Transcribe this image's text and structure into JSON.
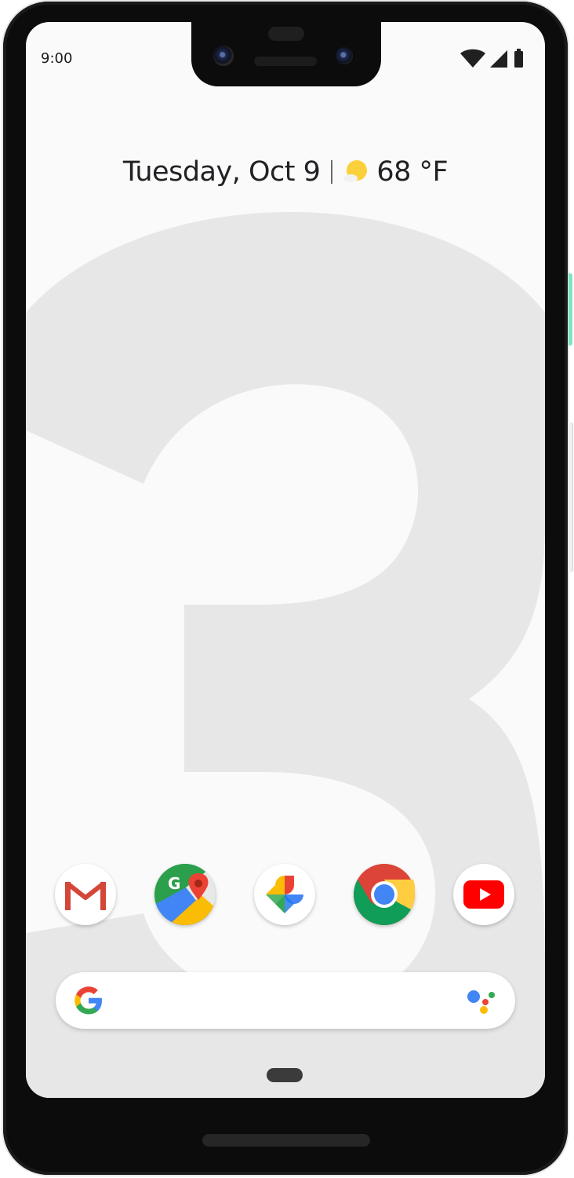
{
  "status_bar": {
    "time": "9:00",
    "icons": [
      "wifi-icon",
      "cell-signal-icon",
      "battery-icon"
    ]
  },
  "glance": {
    "date": "Tuesday, Oct 9",
    "weather_icon": "sun-icon",
    "temperature": "68 °F"
  },
  "dock": {
    "apps": [
      {
        "name": "Gmail",
        "icon": "gmail-icon"
      },
      {
        "name": "Maps",
        "icon": "maps-icon"
      },
      {
        "name": "Photos",
        "icon": "photos-icon"
      },
      {
        "name": "Chrome",
        "icon": "chrome-icon"
      },
      {
        "name": "YouTube",
        "icon": "youtube-icon"
      }
    ]
  },
  "search_bar": {
    "left_icon": "google-g-icon",
    "right_icon": "google-assistant-icon"
  },
  "wallpaper": {
    "glyph": "3",
    "color": "#e7e7e7"
  },
  "colors": {
    "accent_power_button": "#7fe3bf",
    "google_blue": "#4285F4",
    "google_red": "#EA4335",
    "google_yellow": "#FBBC05",
    "google_green": "#34A853"
  }
}
